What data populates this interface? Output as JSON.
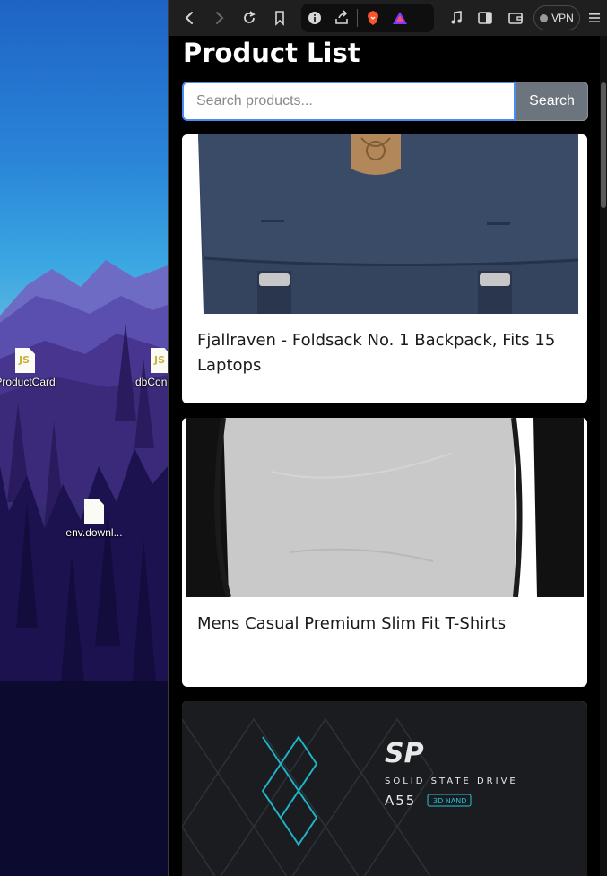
{
  "desktop": {
    "icons": [
      {
        "label": "ProductCard",
        "badge": "JS"
      },
      {
        "label": "dbCon",
        "badge": "JS"
      },
      {
        "label": "env.downl...",
        "badge": ""
      }
    ]
  },
  "browser": {
    "toolbar": {
      "back_icon": "chevron-left-icon",
      "forward_icon": "chevron-right-icon",
      "reload_icon": "reload-icon",
      "bookmark_icon": "bookmark-icon",
      "info_icon": "info-icon",
      "share_icon": "share-icon",
      "vpn_label": "VPN"
    }
  },
  "page": {
    "title": "Product List",
    "search": {
      "placeholder": "Search products...",
      "value": "",
      "button_label": "Search"
    },
    "products": [
      {
        "title": "Fjallraven - Foldsack No. 1 Backpack, Fits 15 Laptops",
        "image": "navy backpack"
      },
      {
        "title": "Mens Casual Premium Slim Fit T-Shirts",
        "image": "raglan t-shirt"
      },
      {
        "title": "",
        "image": "ssd product box"
      }
    ],
    "ssd_brand": "SP",
    "ssd_line": "Solid State Drive",
    "ssd_model": "A55",
    "ssd_badge": "3D NAND"
  },
  "colors": {
    "accent": "#4a8df0",
    "button": "#6c757d",
    "page_bg": "#000000"
  }
}
